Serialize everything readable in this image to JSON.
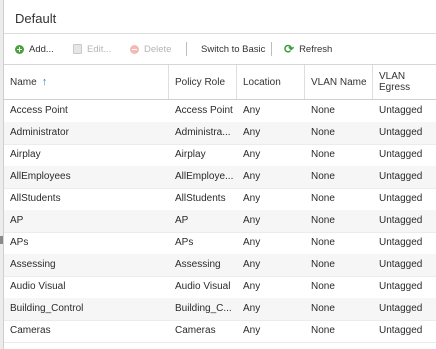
{
  "panel": {
    "title": "Default"
  },
  "toolbar": {
    "add": {
      "label": "Add...",
      "icon": "plus-circle-icon"
    },
    "edit": {
      "label": "Edit...",
      "icon": "edit-icon"
    },
    "delete": {
      "label": "Delete",
      "icon": "minus-circle-icon"
    },
    "switch": {
      "label": "Switch to Basic"
    },
    "refresh": {
      "label": "Refresh",
      "icon": "refresh-icon"
    }
  },
  "table": {
    "columns": [
      "Name",
      "Policy Role",
      "Location",
      "VLAN Name",
      "VLAN Egress"
    ],
    "sort_indicator": "↑",
    "rows": [
      [
        "Access Point",
        "Access Point",
        "Any",
        "None",
        "Untagged"
      ],
      [
        "Administrator",
        "Administra...",
        "Any",
        "None",
        "Untagged"
      ],
      [
        "Airplay",
        "Airplay",
        "Any",
        "None",
        "Untagged"
      ],
      [
        "AllEmployees",
        "AllEmploye...",
        "Any",
        "None",
        "Untagged"
      ],
      [
        "AllStudents",
        "AllStudents",
        "Any",
        "None",
        "Untagged"
      ],
      [
        "AP",
        "AP",
        "Any",
        "None",
        "Untagged"
      ],
      [
        "APs",
        "APs",
        "Any",
        "None",
        "Untagged"
      ],
      [
        "Assessing",
        "Assessing",
        "Any",
        "None",
        "Untagged"
      ],
      [
        "Audio Visual",
        "Audio Visual",
        "Any",
        "None",
        "Untagged"
      ],
      [
        "Building_Control",
        "Building_C...",
        "Any",
        "None",
        "Untagged"
      ],
      [
        "Cameras",
        "Cameras",
        "Any",
        "None",
        "Untagged"
      ]
    ]
  }
}
